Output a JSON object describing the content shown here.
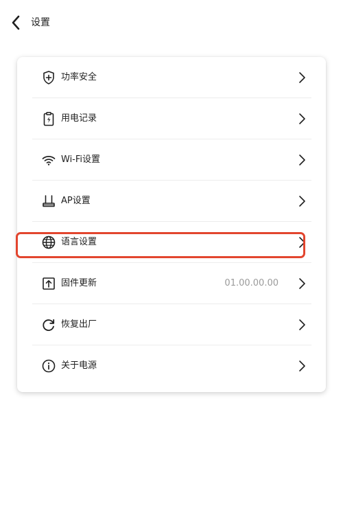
{
  "header": {
    "title": "设置",
    "back_icon": "chevron-left-icon"
  },
  "colors": {
    "highlight": "#e2452e",
    "value_text": "#9a9a9a",
    "divider": "#ececec"
  },
  "menu": {
    "items": [
      {
        "id": "power-security",
        "label": "功率安全",
        "icon": "shield-plus-icon",
        "value": ""
      },
      {
        "id": "power-records",
        "label": "用电记录",
        "icon": "clipboard-bolt-icon",
        "value": ""
      },
      {
        "id": "wifi-settings",
        "label": "Wi-Fi设置",
        "icon": "wifi-icon",
        "value": ""
      },
      {
        "id": "ap-settings",
        "label": "AP设置",
        "icon": "router-icon",
        "value": ""
      },
      {
        "id": "language-settings",
        "label": "语言设置",
        "icon": "globe-icon",
        "value": "",
        "highlighted": true
      },
      {
        "id": "firmware-update",
        "label": "固件更新",
        "icon": "upload-box-icon",
        "value": "01.00.00.00"
      },
      {
        "id": "factory-reset",
        "label": "恢复出厂",
        "icon": "refresh-icon",
        "value": ""
      },
      {
        "id": "about-power",
        "label": "关于电源",
        "icon": "info-icon",
        "value": ""
      }
    ]
  }
}
